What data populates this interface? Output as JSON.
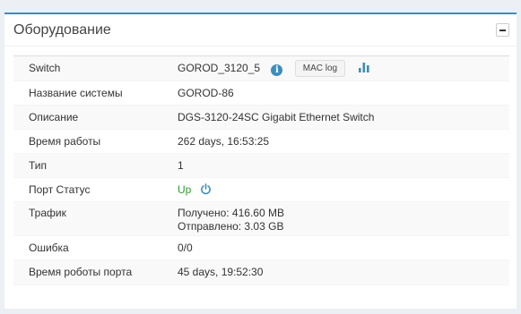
{
  "panel": {
    "title": "Оборудование"
  },
  "rows": [
    {
      "label": "Switch",
      "value": "GOROD_3120_5",
      "mac_button": "MAC log"
    },
    {
      "label": "Название системы",
      "value": "GOROD-86"
    },
    {
      "label": "Описание",
      "value": "DGS-3120-24SC Gigabit Ethernet Switch"
    },
    {
      "label": "Время работы",
      "value": "262 days, 16:53:25"
    },
    {
      "label": "Тип",
      "value": "1"
    },
    {
      "label": "Порт Статус",
      "value": "Up"
    },
    {
      "label": "Трафик",
      "received": "Получено: 416.60 MB",
      "sent": "Отправлено: 3.03 GB"
    },
    {
      "label": "Ошибка",
      "value": "0/0"
    },
    {
      "label": "Время роботы порта",
      "value": "45 days, 19:52:30"
    }
  ],
  "colors": {
    "accent": "#3c8dbc",
    "status_up": "#2a9d2a"
  },
  "icons": {
    "info": "info-circle-icon",
    "chart": "bar-chart-icon",
    "power": "power-icon",
    "collapse": "minus-icon"
  }
}
